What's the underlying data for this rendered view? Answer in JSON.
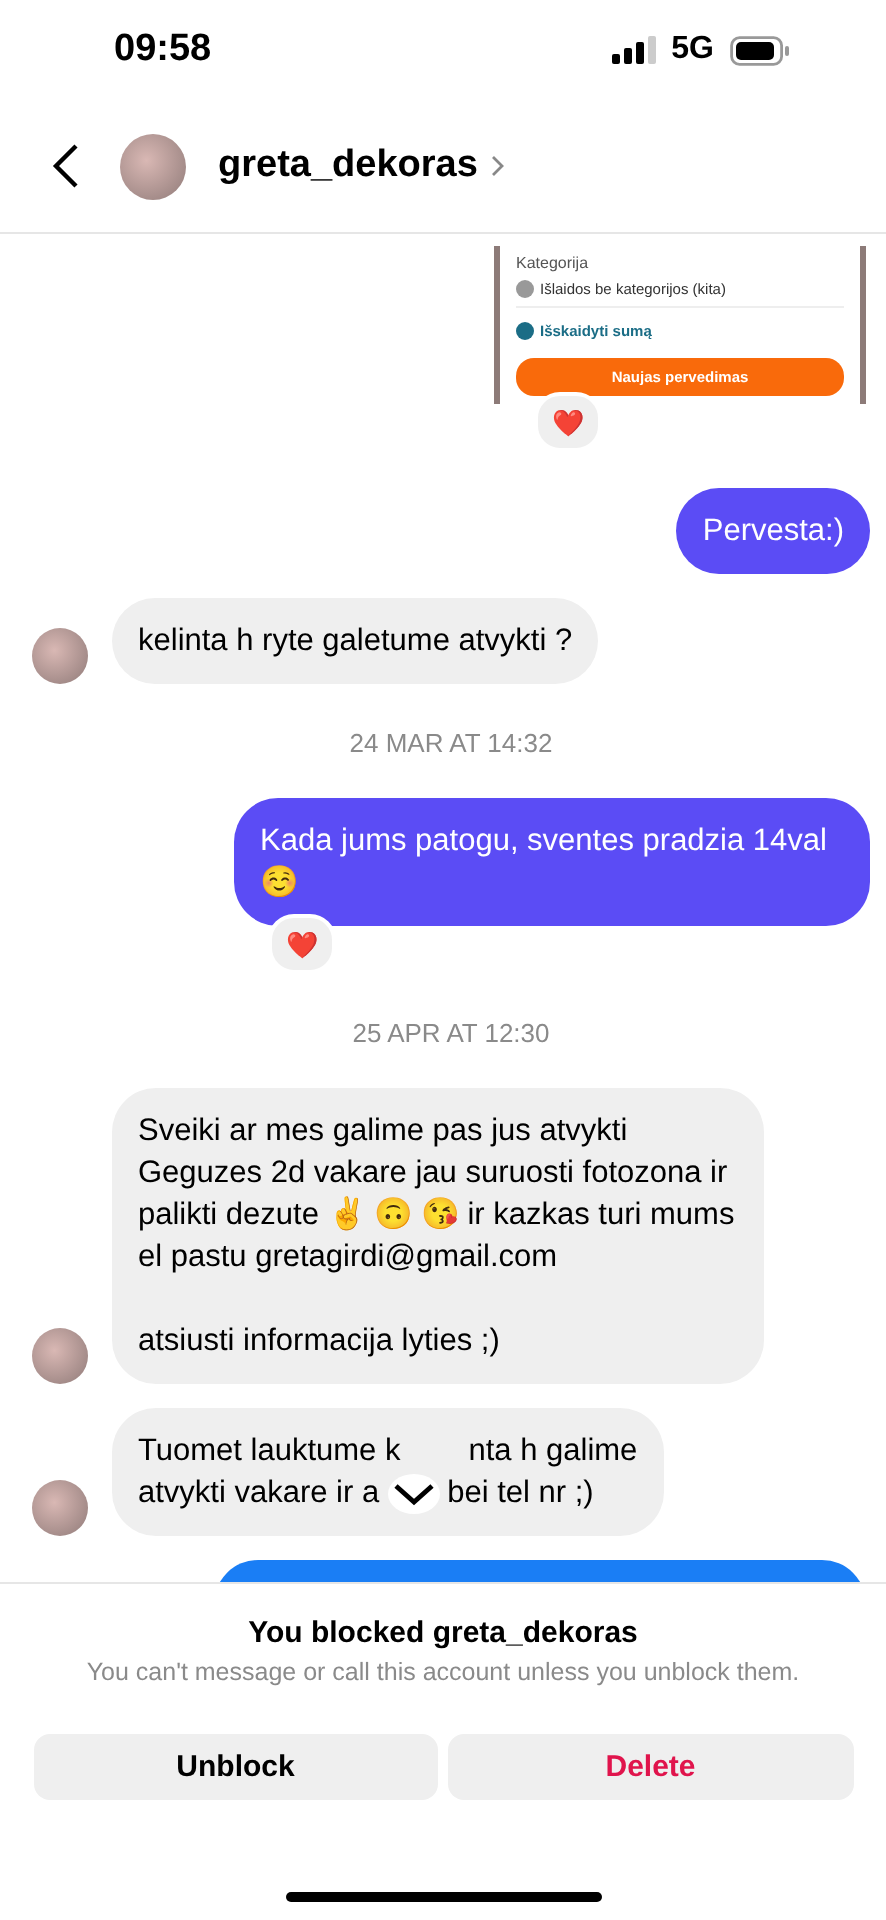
{
  "status_bar": {
    "time": "09:58",
    "network": "5G"
  },
  "header": {
    "username": "greta_dekoras"
  },
  "messages": [
    {
      "kind": "shared_image",
      "category_label": "Kategorija",
      "category": "Išlaidos be kategorijos (kita)",
      "split_link": "Išskaidyti sumą",
      "button": "Naujas pervedimas",
      "reaction": "❤️"
    },
    {
      "kind": "sent",
      "lines": [
        [
          "Pervesta:)"
        ]
      ]
    },
    {
      "kind": "received",
      "avatar": true,
      "lines": [
        [
          "kelinta h ryte galetume atvykti ?"
        ]
      ]
    },
    {
      "kind": "timestamp",
      "text": "24 MAR AT 14:32"
    },
    {
      "kind": "sent",
      "lines": [
        [
          "Kada jums patogu, sventes pradzia 14val ☺️"
        ]
      ],
      "reaction": "❤️"
    },
    {
      "kind": "timestamp",
      "text": "25 APR AT 12:30"
    },
    {
      "kind": "received",
      "avatar": true,
      "lines": [
        [
          "Sveiki ar mes galime pas jus atvykti Geguzes 2d vakare jau suruosti fotozona ir palikti dezute ✌️ 🙃 😘 ir kazkas turi mums el pastu gretagirdi@gmail.com"
        ],
        [
          "atsiusti informacija lyties ;)"
        ]
      ]
    },
    {
      "kind": "received_covered",
      "avatar": true,
      "lines": [
        [
          "Tuomet lauktume k",
          "nta h galime"
        ],
        [
          "atvykti vakare ir a",
          "bei tel nr ;)"
        ]
      ]
    },
    {
      "kind": "sent_cut"
    }
  ],
  "blocked": {
    "title": "You blocked greta_dekoras",
    "subtitle": "You can't message or call this account unless you unblock them.",
    "buttons": [
      {
        "label": "Unblock",
        "kind": "default"
      },
      {
        "label": "Delete",
        "kind": "danger"
      }
    ]
  }
}
